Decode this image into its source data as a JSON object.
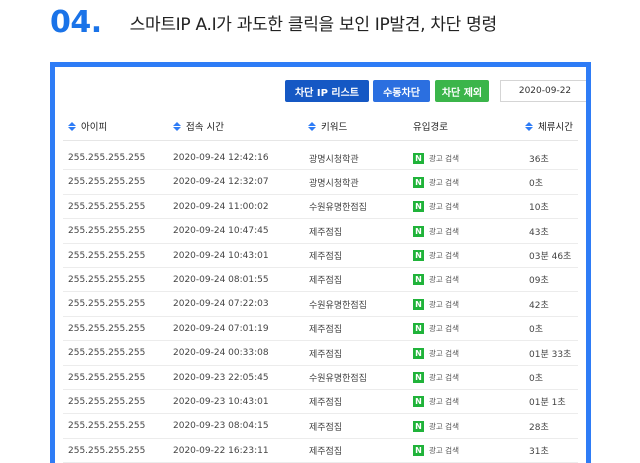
{
  "header": {
    "step_number": "04.",
    "title": "스마트IP A.I가 과도한 클릭을 보인 IP발견, 차단 명령"
  },
  "toolbar": {
    "block_list_label": "차단 IP 리스트",
    "manual_block_label": "수동차단",
    "unblock_label": "차단 제외",
    "date_value": "2020-09-22"
  },
  "table": {
    "columns": {
      "ip": "아이피",
      "access_time": "접속 시간",
      "keyword": "키워드",
      "route": "유입경로",
      "dwell": "체류시간"
    },
    "rows": [
      {
        "ip": "255.255.255.255",
        "time": "2020-09-24 12:42:16",
        "keyword": "광명시청학관",
        "route": "광고 검색",
        "dwell": "36초"
      },
      {
        "ip": "255.255.255.255",
        "time": "2020-09-24 12:32:07",
        "keyword": "광명시청학관",
        "route": "광고 검색",
        "dwell": "0초"
      },
      {
        "ip": "255.255.255.255",
        "time": "2020-09-24 11:00:02",
        "keyword": "수원유명한점집",
        "route": "광고 검색",
        "dwell": "10초"
      },
      {
        "ip": "255.255.255.255",
        "time": "2020-09-24 10:47:45",
        "keyword": "제주점집",
        "route": "광고 검색",
        "dwell": "43초"
      },
      {
        "ip": "255.255.255.255",
        "time": "2020-09-24 10:43:01",
        "keyword": "제주점집",
        "route": "광고 검색",
        "dwell": "03분 46초"
      },
      {
        "ip": "255.255.255.255",
        "time": "2020-09-24 08:01:55",
        "keyword": "제주점집",
        "route": "광고 검색",
        "dwell": "09초"
      },
      {
        "ip": "255.255.255.255",
        "time": "2020-09-24 07:22:03",
        "keyword": "수원유명한점집",
        "route": "광고 검색",
        "dwell": "42초"
      },
      {
        "ip": "255.255.255.255",
        "time": "2020-09-24 07:01:19",
        "keyword": "제주점집",
        "route": "광고 검색",
        "dwell": "0초"
      },
      {
        "ip": "255.255.255.255",
        "time": "2020-09-24 00:33:08",
        "keyword": "제주점집",
        "route": "광고 검색",
        "dwell": "01분 33초"
      },
      {
        "ip": "255.255.255.255",
        "time": "2020-09-23 22:05:45",
        "keyword": "수원유명한점집",
        "route": "광고 검색",
        "dwell": "0초"
      },
      {
        "ip": "255.255.255.255",
        "time": "2020-09-23 10:43:01",
        "keyword": "제주점집",
        "route": "광고 검색",
        "dwell": "01분 1초"
      },
      {
        "ip": "255.255.255.255",
        "time": "2020-09-23 08:04:15",
        "keyword": "제주점집",
        "route": "광고 검색",
        "dwell": "28초"
      },
      {
        "ip": "255.255.255.255",
        "time": "2020-09-22 16:23:11",
        "keyword": "제주점집",
        "route": "광고 검색",
        "dwell": "31초"
      }
    ]
  },
  "icons": {
    "sort": "sort-updown-icon",
    "naver": "naver-n-icon",
    "naver_label": "N"
  },
  "colors": {
    "accent_blue": "#2e7cf6",
    "dark_blue_button": "#1558c4",
    "green_button": "#3bb54a",
    "naver_green": "#20b33a"
  }
}
